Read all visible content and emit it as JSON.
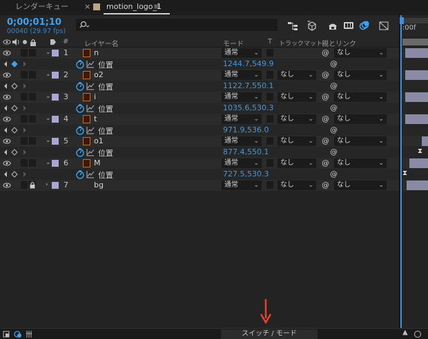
{
  "tabs": [
    {
      "label": "レンダーキュー"
    },
    {
      "label": "motion_logo_1",
      "close": "×",
      "menu": "≡"
    }
  ],
  "timecode": "0;00;01;10",
  "frame_info": "00040 (29.97 fps)",
  "search": {
    "placeholder": "",
    "icon": "search-icon"
  },
  "columns": {
    "number": "#",
    "layer_name": "レイヤー名",
    "mode": "モード",
    "t": "T",
    "track_matte": "トラックマット",
    "parent_link": "親とリンク"
  },
  "layers": [
    {
      "num": "1",
      "name": "n",
      "mode": "通常",
      "matte": "",
      "parent": "なし",
      "prop": "位置",
      "value": "1244.7,549.9",
      "keyframe_active": true
    },
    {
      "num": "2",
      "name": "o2",
      "mode": "通常",
      "matte": "なし",
      "parent": "なし",
      "prop": "位置",
      "value": "1122.7,550.1",
      "keyframe_active": false
    },
    {
      "num": "3",
      "name": "i",
      "mode": "通常",
      "matte": "なし",
      "parent": "なし",
      "prop": "位置",
      "value": "1035.6,530.3",
      "keyframe_active": false
    },
    {
      "num": "4",
      "name": "t",
      "mode": "通常",
      "matte": "なし",
      "parent": "なし",
      "prop": "位置",
      "value": "971.9,536.0",
      "keyframe_active": false
    },
    {
      "num": "5",
      "name": "o1",
      "mode": "通常",
      "matte": "なし",
      "parent": "なし",
      "prop": "位置",
      "value": "877.4,550.1",
      "keyframe_active": false
    },
    {
      "num": "6",
      "name": "M",
      "mode": "通常",
      "matte": "なし",
      "parent": "なし",
      "prop": "位置",
      "value": "727.5,530.3",
      "keyframe_active": false
    },
    {
      "num": "7",
      "name": "bg",
      "mode": "通常",
      "matte": "なし",
      "parent": "なし",
      "locked": true
    }
  ],
  "timeline": {
    "ruler_label": "):00f"
  },
  "footer": {
    "toggle_label": "スイッチ / モード"
  },
  "colors": {
    "accent": "#3da2f2",
    "label": "#a9a6d6",
    "arrow": "#e8412c"
  }
}
